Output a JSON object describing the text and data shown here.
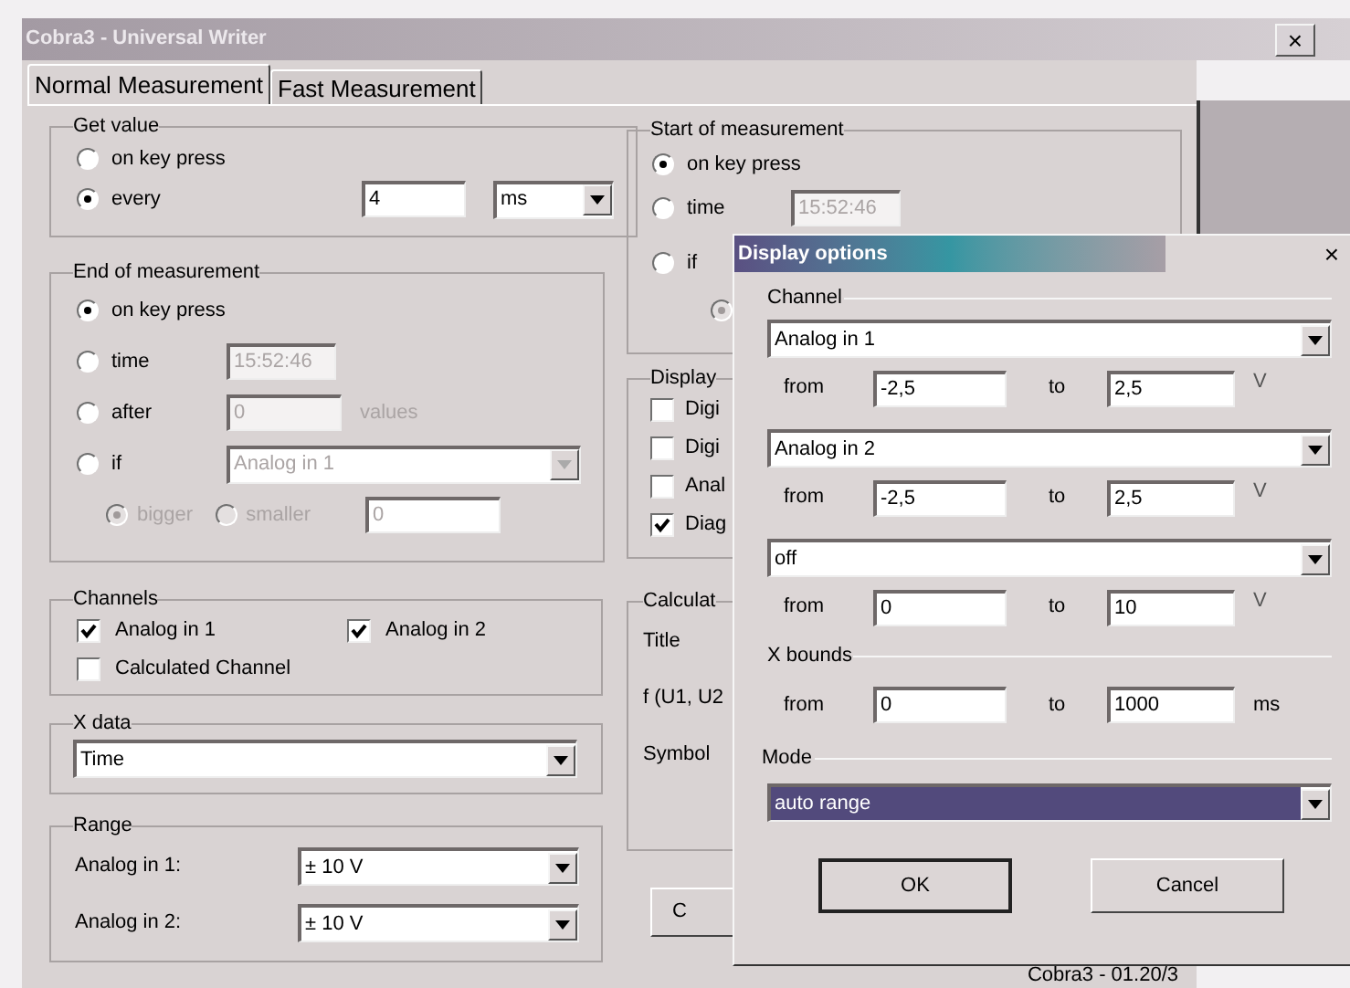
{
  "window": {
    "title": "Cobra3 - Universal Writer",
    "close": "×"
  },
  "tabs": [
    {
      "label": "Normal Measurement",
      "selected": true
    },
    {
      "label": "Fast Measurement",
      "selected": false
    }
  ],
  "get_value": {
    "title": "Get value",
    "options": [
      {
        "label": "on key press",
        "selected": false
      },
      {
        "label": "every",
        "selected": true
      }
    ],
    "interval": "4",
    "unit": "ms"
  },
  "end_of_measurement": {
    "title": "End of measurement",
    "options": [
      {
        "label": "on key press",
        "selected": true,
        "kind": "plain"
      },
      {
        "label": "time",
        "selected": false,
        "kind": "field",
        "value": "15:52:46",
        "disabled": true
      },
      {
        "label": "after",
        "selected": false,
        "kind": "count",
        "value": "0",
        "suffix": "values",
        "disabled": true
      },
      {
        "label": "if",
        "selected": false,
        "kind": "select",
        "value": "Analog in 1",
        "disabled": true
      }
    ],
    "comparisons": [
      {
        "label": "bigger",
        "selected": true,
        "disabled": true
      },
      {
        "label": "smaller",
        "selected": false,
        "disabled": true
      }
    ],
    "threshold": "0"
  },
  "start_of_measurement": {
    "title": "Start of measurement",
    "options": [
      {
        "label": "on key press",
        "selected": true,
        "kind": "plain"
      },
      {
        "label": "time",
        "selected": false,
        "kind": "field",
        "value": "15:52:46",
        "disabled": true
      },
      {
        "label": "if",
        "selected": false,
        "kind": "plain"
      }
    ],
    "comparisons": [
      {
        "selected": true,
        "disabled": true
      }
    ]
  },
  "display": {
    "title": "Display",
    "items": [
      {
        "label": "Digi",
        "checked": false
      },
      {
        "label": "Digi",
        "checked": false
      },
      {
        "label": "Anal",
        "checked": false
      },
      {
        "label": "Diag",
        "checked": true
      }
    ]
  },
  "channels": {
    "title": "Channels",
    "items": [
      {
        "label": "Analog in 1",
        "checked": true
      },
      {
        "label": "Analog in 2",
        "checked": true
      },
      {
        "label": "Calculated Channel",
        "checked": false
      }
    ]
  },
  "x_data": {
    "title": "X data",
    "value": "Time"
  },
  "range": {
    "title": "Range",
    "rows": [
      {
        "label": "Analog in 1:",
        "value": "± 10 V"
      },
      {
        "label": "Analog in 2:",
        "value": "± 10 V"
      }
    ]
  },
  "calculation": {
    "title": "Calculat",
    "labels": [
      "Title",
      "f (U1, U2",
      "Symbol"
    ]
  },
  "button": "C",
  "status": "Cobra3 - 01.20/3",
  "dialog": {
    "title": "Display options",
    "close": "×",
    "channel_title": "Channel",
    "channels": [
      {
        "value": "Analog in 1",
        "from_label": "from",
        "from": "-2,5",
        "to_label": "to",
        "to": "2,5",
        "unit": "V"
      },
      {
        "value": "Analog in 2",
        "from_label": "from",
        "from": "-2,5",
        "to_label": "to",
        "to": "2,5",
        "unit": "V"
      },
      {
        "value": "off",
        "from_label": "from",
        "from": "0",
        "to_label": "to",
        "to": "10",
        "unit": "V"
      }
    ],
    "x_bounds": {
      "title": "X bounds",
      "from_label": "from",
      "from": "0",
      "to_label": "to",
      "to": "1000",
      "unit": "ms"
    },
    "mode": {
      "title": "Mode",
      "value": "auto range",
      "focused": true
    },
    "buttons": [
      {
        "label": "OK",
        "default": true
      },
      {
        "label": "Cancel",
        "default": false
      }
    ]
  }
}
